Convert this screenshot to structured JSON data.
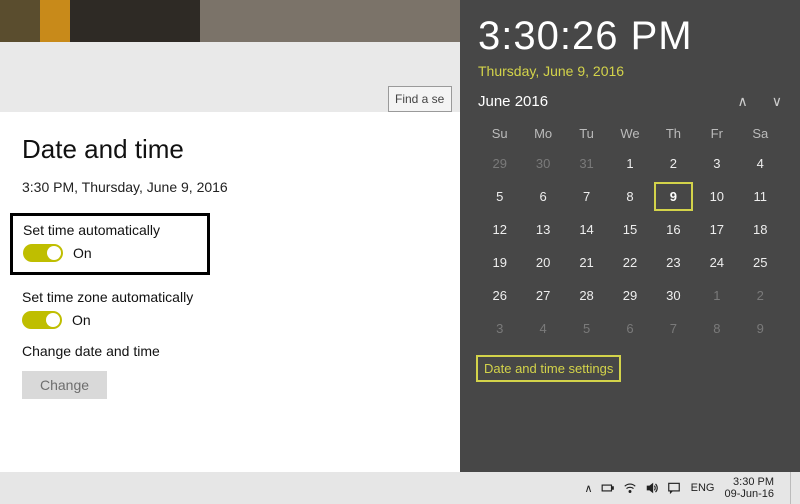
{
  "header": {
    "find_placeholder": "Find a se"
  },
  "settings": {
    "title": "Date and time",
    "now": "3:30 PM, Thursday, June 9, 2016",
    "auto_time": {
      "label": "Set time automatically",
      "state": "On"
    },
    "auto_tz": {
      "label": "Set time zone automatically",
      "state": "On"
    },
    "change_label": "Change date and time",
    "change_button": "Change"
  },
  "flyout": {
    "time": "3:30:26 PM",
    "date": "Thursday, June 9, 2016",
    "month": "June 2016",
    "dow": [
      "Su",
      "Mo",
      "Tu",
      "We",
      "Th",
      "Fr",
      "Sa"
    ],
    "weeks": [
      [
        {
          "n": 29,
          "dim": true
        },
        {
          "n": 30,
          "dim": true
        },
        {
          "n": 31,
          "dim": true
        },
        {
          "n": 1
        },
        {
          "n": 2
        },
        {
          "n": 3
        },
        {
          "n": 4
        }
      ],
      [
        {
          "n": 5
        },
        {
          "n": 6
        },
        {
          "n": 7
        },
        {
          "n": 8
        },
        {
          "n": 9,
          "today": true
        },
        {
          "n": 10
        },
        {
          "n": 11
        }
      ],
      [
        {
          "n": 12
        },
        {
          "n": 13
        },
        {
          "n": 14
        },
        {
          "n": 15
        },
        {
          "n": 16
        },
        {
          "n": 17
        },
        {
          "n": 18
        }
      ],
      [
        {
          "n": 19
        },
        {
          "n": 20
        },
        {
          "n": 21
        },
        {
          "n": 22
        },
        {
          "n": 23
        },
        {
          "n": 24
        },
        {
          "n": 25
        }
      ],
      [
        {
          "n": 26
        },
        {
          "n": 27
        },
        {
          "n": 28
        },
        {
          "n": 29
        },
        {
          "n": 30
        },
        {
          "n": 1,
          "dim": true
        },
        {
          "n": 2,
          "dim": true
        }
      ],
      [
        {
          "n": 3,
          "dim": true
        },
        {
          "n": 4,
          "dim": true
        },
        {
          "n": 5,
          "dim": true
        },
        {
          "n": 6,
          "dim": true
        },
        {
          "n": 7,
          "dim": true
        },
        {
          "n": 8,
          "dim": true
        },
        {
          "n": 9,
          "dim": true
        }
      ]
    ],
    "link": "Date and time settings"
  },
  "taskbar": {
    "lang": "ENG",
    "time": "3:30 PM",
    "date": "09-Jun-16"
  }
}
